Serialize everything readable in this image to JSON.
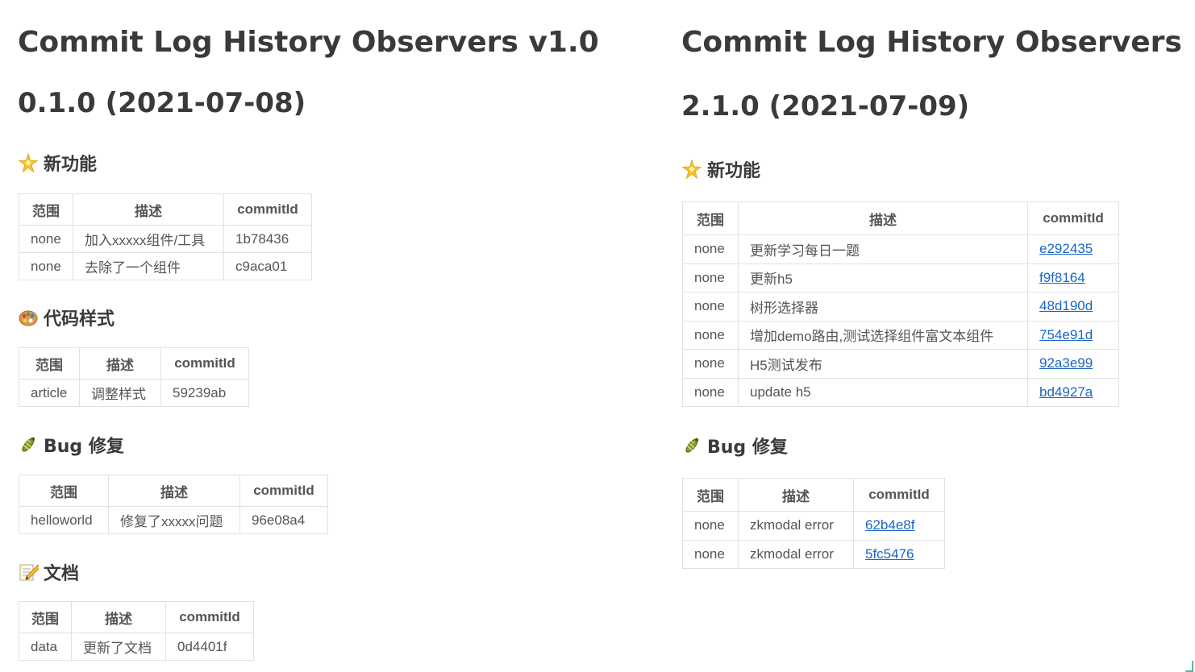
{
  "left": {
    "title": "Commit Log History Observers v1.0",
    "version": "0.1.0 (2021-07-08)",
    "sections": [
      {
        "icon": "sparkle-star-icon",
        "title": "新功能",
        "headers": [
          "范围",
          "描述",
          "commitId"
        ],
        "rows": [
          [
            "none",
            "加入xxxxx组件/工具",
            "1b78436"
          ],
          [
            "none",
            "去除了一个组件",
            "c9aca01"
          ]
        ]
      },
      {
        "icon": "art-palette-icon",
        "title": "代码样式",
        "headers": [
          "范围",
          "描述",
          "commitId"
        ],
        "rows": [
          [
            "article",
            "调整样式",
            "59239ab"
          ]
        ]
      },
      {
        "icon": "bug-icon",
        "title": "Bug 修复",
        "headers": [
          "范围",
          "描述",
          "commitId"
        ],
        "rows": [
          [
            "helloworld",
            "修复了xxxxx问题",
            "96e08a4"
          ]
        ]
      },
      {
        "icon": "memo-pencil-icon",
        "title": "文档",
        "headers": [
          "范围",
          "描述",
          "commitId"
        ],
        "rows": [
          [
            "data",
            "更新了文档",
            "0d4401f"
          ]
        ]
      }
    ]
  },
  "right": {
    "title": "Commit Log History Observers",
    "version": "2.1.0 (2021-07-09)",
    "sections": [
      {
        "icon": "sparkle-star-icon",
        "title": "新功能",
        "headers": [
          "范围",
          "描述",
          "commitId"
        ],
        "rows": [
          [
            "none",
            "更新学习每日一题",
            "e292435"
          ],
          [
            "none",
            "更新h5",
            "f9f8164"
          ],
          [
            "none",
            "树形选择器",
            "48d190d"
          ],
          [
            "none",
            "增加demo路由,测试选择组件富文本组件",
            "754e91d"
          ],
          [
            "none",
            "H5测试发布",
            "92a3e99"
          ],
          [
            "none",
            "update h5",
            "bd4927a"
          ]
        ]
      },
      {
        "icon": "bug-icon",
        "title": "Bug 修复",
        "headers": [
          "范围",
          "描述",
          "commitId"
        ],
        "rows": [
          [
            "none",
            "zkmodal error",
            "62b4e8f"
          ],
          [
            "none",
            "zkmodal error",
            "5fc5476"
          ]
        ]
      }
    ]
  },
  "colors": {
    "text": "#333333",
    "heading": "#3a3a3a",
    "table_border": "#dfe2e5",
    "link": "#1a66c4"
  }
}
